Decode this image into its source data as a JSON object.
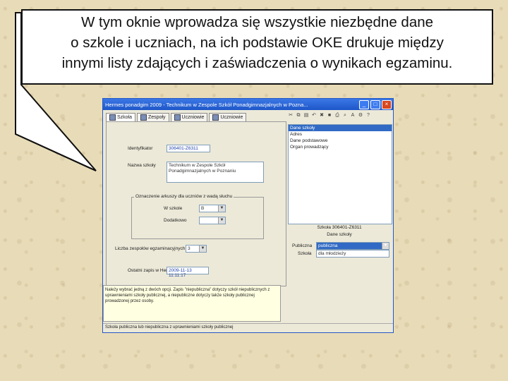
{
  "callout": {
    "lines": [
      "W tym oknie wprowadza się wszystkie niezbędne dane",
      "o szkole i uczniach, na ich podstawie OKE drukuje między",
      "innymi listy zdających i zaświadczenia o wynikach egzaminu."
    ]
  },
  "window": {
    "title": "Hermes ponadgim 2009 - Technikum w Zespole Szkół Ponadgimnazjalnych w Pozna...",
    "tabs": [
      "Szkoła",
      "Zespoły",
      "Uczniowie",
      "Uczniowie"
    ],
    "form": {
      "identifier_label": "Identyfikator",
      "identifier_value": "306401-Z6311",
      "name_label": "Nazwa szkoły",
      "name_value_1": "Technikum w Zespole Szkół",
      "name_value_2": "Ponadgimnazjalnych w Poznaniu",
      "group_title": "Oznaczenie arkuszy dla uczniów z wadą słuchu",
      "sub1_label": "W szkole",
      "sub1_value": "B",
      "sub2_label": "Dodatkowo",
      "sub2_value": "",
      "count_label": "Liczba zespołów egzaminacyjnych",
      "count_value": "3",
      "saved_label": "Ostatni zapis w Hermesie",
      "saved_value": "2009-11-13 11:11:17"
    },
    "list_items": [
      "Dane szkoły",
      "Adres",
      "Dane podstawowe",
      "Organ prowadzący"
    ],
    "list_selected": 0,
    "info_line1": "Szkoła 306401-Z6311",
    "info_line2": "Dane szkoły",
    "publish_label": "Publiczna",
    "publish_value": "publiczna",
    "school_label": "Szkoła",
    "school_value": "dla młodzieży",
    "message": "Należy wybrać jedną z dwóch opcji. Zapis \"niepubliczna\" dotyczy szkół niepublicznych z uprawnieniami szkoły publicznej, a niepubliczne dotyczy także szkoły publicznej prowadzonej przez osoby.",
    "status": "Szkoła publiczna lub niepubliczna z uprawnieniami szkoły publicznej"
  }
}
